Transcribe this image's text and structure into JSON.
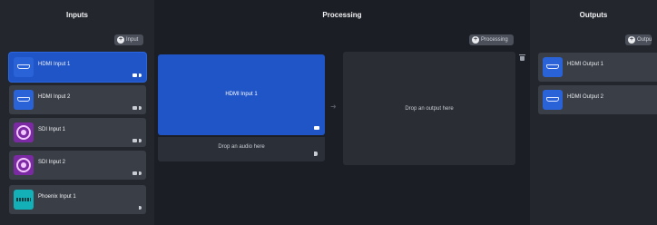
{
  "columns": {
    "inputs_title": "Inputs",
    "processing_title": "Processing",
    "outputs_title": "Outputs"
  },
  "buttons": {
    "add_input": "Input",
    "add_processing": "Processing",
    "add_output": "Outpu"
  },
  "inputs": [
    {
      "label": "HDMI Input 1",
      "icon": "hdmi-icon",
      "active": true
    },
    {
      "label": "HDMI Input 2",
      "icon": "hdmi-icon",
      "active": false
    },
    {
      "label": "SDI Input 1",
      "icon": "sdi-icon",
      "active": false
    },
    {
      "label": "SDI Input 2",
      "icon": "sdi-icon",
      "active": false
    },
    {
      "label": "Phoenix Input 1",
      "icon": "phoenix-connector-icon",
      "active": false
    }
  ],
  "processing": {
    "video_source_label": "HDMI Input 1",
    "audio_drop_label": "Drop an audio here",
    "output_drop_label": "Drop an output here"
  },
  "outputs": [
    {
      "label": "HDMI Output 1",
      "icon": "hdmi-icon"
    },
    {
      "label": "HDMI Output 2",
      "icon": "hdmi-icon"
    }
  ],
  "colors": {
    "accent_blue": "#1f55c7",
    "sdi_purple": "#7c2aa3",
    "phoenix_teal": "#14b0b8",
    "card_gray": "#3a3e46"
  }
}
